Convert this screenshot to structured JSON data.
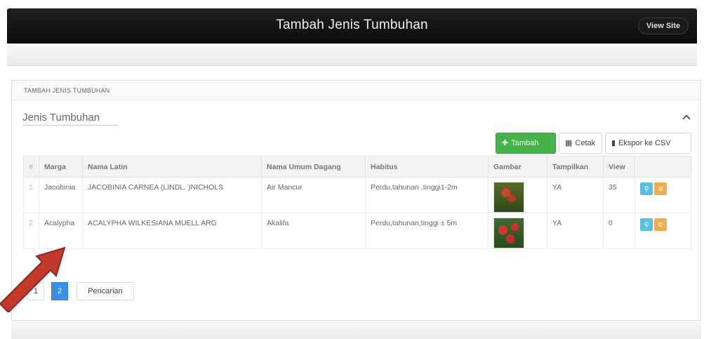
{
  "header": {
    "title": "Tambah Jenis Tumbuhan",
    "view_site": "View Site"
  },
  "breadcrumb": "TAMBAH JENIS TUMBUHAN",
  "section": {
    "title": "Jenis Tumbuhan"
  },
  "toolbar": {
    "add_label": "Tambah",
    "print_label": "Cetak",
    "csv_label": "Ekspor ke CSV"
  },
  "table": {
    "headers": [
      "#",
      "Marga",
      "Nama Latin",
      "Nama Umum Dagang",
      "Habitus",
      "Gambar",
      "Tampilkan",
      "View",
      ""
    ],
    "rows": [
      {
        "no": "1",
        "marga": "Jacobinia",
        "nama_latin": "JACOBINIA CARNEA (LINDL. )NICHOLS",
        "nama_umum": "Air Mancur",
        "habitus": "Perdu,tahunan ,tinggi1-2m",
        "tampilkan": "YA",
        "view": "35"
      },
      {
        "no": "2",
        "marga": "Acalypha",
        "nama_latin": "ACALYPHA WILKESIANA MUELL ARG",
        "nama_umum": "Akalifa",
        "habitus": "Perdu,tahunan,tinggi ± 5m",
        "tampilkan": "YA",
        "view": "0"
      }
    ]
  },
  "pagination": {
    "pages": [
      "1",
      "2"
    ],
    "search_label": "Pencarian"
  },
  "colors": {
    "header_bg": "#111111",
    "add_button": "#47b24b",
    "active_page": "#3a8ee6",
    "view_action": "#5bc0de",
    "edit_action": "#f0ad4e",
    "arrow": "#c0392b"
  }
}
